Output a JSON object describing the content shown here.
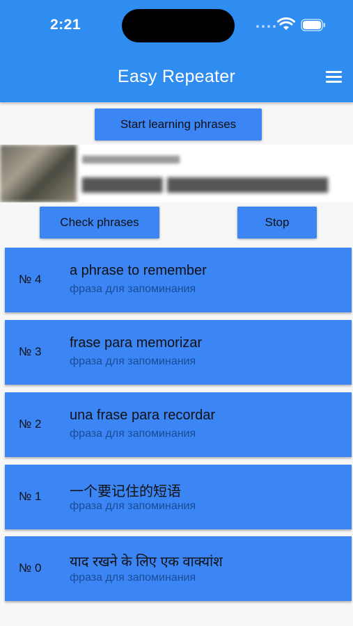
{
  "status_bar": {
    "time": "2:21"
  },
  "app_bar": {
    "title": "Easy Repeater",
    "menu_icon": "hamburger-menu-icon"
  },
  "buttons": {
    "start": "Start learning phrases",
    "check": "Check phrases",
    "stop": "Stop"
  },
  "phrases": [
    {
      "number": "№ 4",
      "phrase": "a phrase to remember",
      "translation": "фраза для запоминания"
    },
    {
      "number": "№ 3",
      "phrase": "frase para memorizar",
      "translation": "фраза для запоминания"
    },
    {
      "number": "№ 2",
      "phrase": "una frase para recordar",
      "translation": "фраза для запоминания"
    },
    {
      "number": "№ 1",
      "phrase": "一个要记住的短语",
      "translation": "фраза для запоминания"
    },
    {
      "number": "№ 0",
      "phrase": "याद रखने के लिए एक वाक्यांश",
      "translation": "фраза для запоминания"
    }
  ],
  "colors": {
    "app_bar": "#2f8cf1",
    "card": "#3c85f4",
    "background": "#f7f7f7"
  }
}
